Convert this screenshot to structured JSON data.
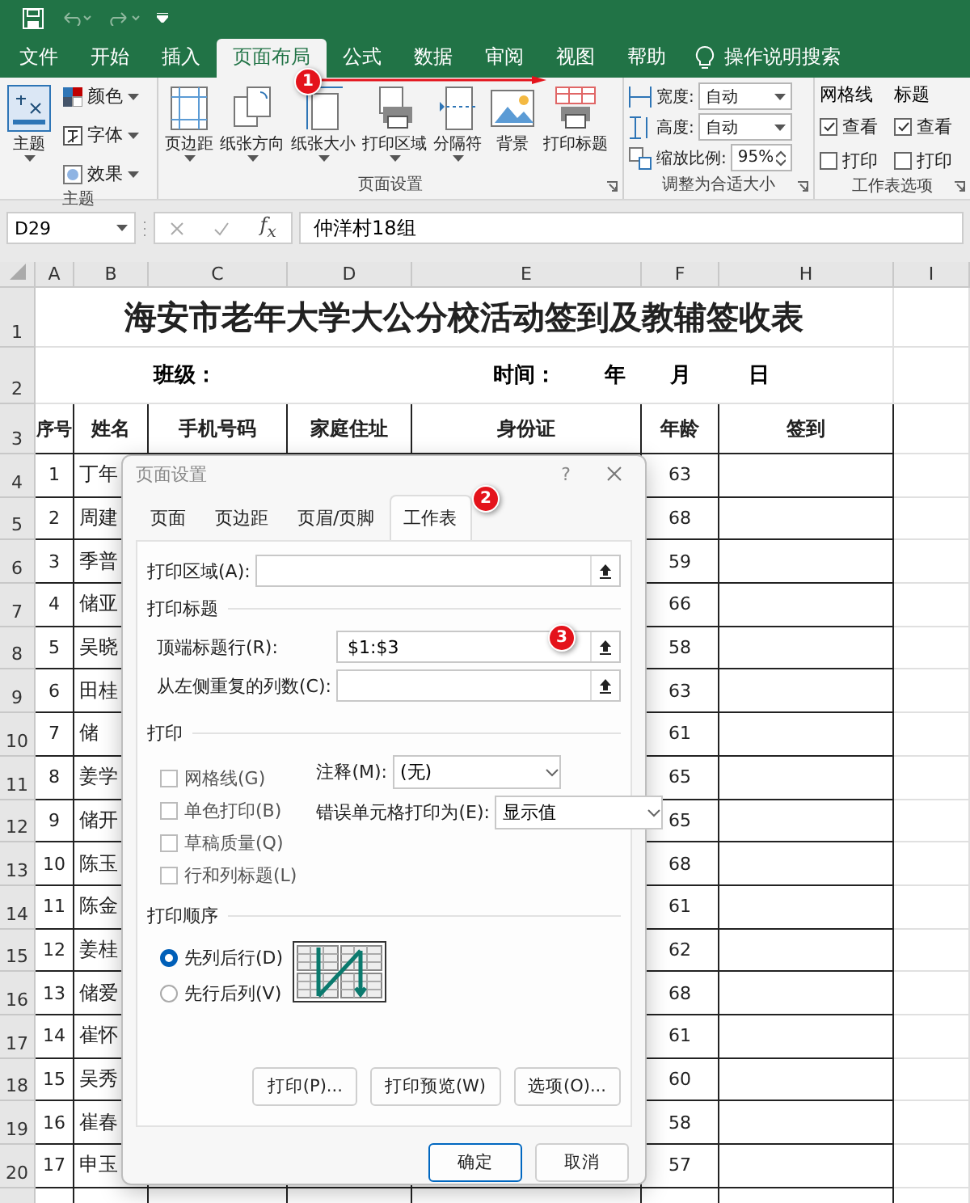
{
  "ribbon_tabs": [
    {
      "label": "文件",
      "selected": false
    },
    {
      "label": "开始",
      "selected": false
    },
    {
      "label": "插入",
      "selected": false
    },
    {
      "label": "页面布局",
      "selected": true
    },
    {
      "label": "公式",
      "selected": false
    },
    {
      "label": "数据",
      "selected": false
    },
    {
      "label": "审阅",
      "selected": false
    },
    {
      "label": "视图",
      "selected": false
    },
    {
      "label": "帮助",
      "selected": false
    }
  ],
  "tell_me": "操作说明搜索",
  "theme_group": {
    "label": "主题",
    "button": "主题",
    "items": [
      "颜色",
      "字体",
      "效果"
    ]
  },
  "page_setup_group": {
    "label": "页面设置",
    "buttons": [
      {
        "label": "页边距",
        "dropdown": true
      },
      {
        "label": "纸张方向",
        "dropdown": true
      },
      {
        "label": "纸张大小",
        "dropdown": true
      },
      {
        "label": "打印区域",
        "dropdown": true
      },
      {
        "label": "分隔符",
        "dropdown": true
      },
      {
        "label": "背景",
        "dropdown": false
      },
      {
        "label": "打印标题",
        "dropdown": false
      }
    ]
  },
  "scale_group": {
    "label": "调整为合适大小",
    "fields": [
      {
        "label": "宽度:",
        "value": "自动"
      },
      {
        "label": "高度:",
        "value": "自动"
      },
      {
        "label": "缩放比例:",
        "value": "95%"
      }
    ]
  },
  "sheet_options_group": {
    "label": "工作表选项",
    "columns": [
      {
        "title": "网格线",
        "options": [
          {
            "label": "查看",
            "checked": true
          },
          {
            "label": "打印",
            "checked": false
          }
        ]
      },
      {
        "title": "标题",
        "options": [
          {
            "label": "查看",
            "checked": true
          },
          {
            "label": "打印",
            "checked": false
          }
        ]
      }
    ]
  },
  "formula_bar": {
    "name_box": "D29",
    "function_label": "f$_{x}$",
    "formula": "仲洋村18组"
  },
  "sheet": {
    "columns": [
      "A",
      "B",
      "C",
      "D",
      "E",
      "F",
      "H",
      "I"
    ],
    "title_row": {
      "number": "1",
      "text": "海安市老年大学大公分校活动签到及教辅签收表"
    },
    "info_row": {
      "number": "2",
      "class_label": "班级：",
      "time_label": "时间：",
      "year": "年",
      "month": "月",
      "day": "日"
    },
    "header_row": {
      "number": "3",
      "cells": [
        "序号",
        "姓名",
        "手机号码",
        "家庭住址",
        "身份证",
        "年龄",
        "签到"
      ]
    },
    "rows": [
      {
        "number": "4",
        "seq": "1",
        "name": "丁年",
        "age": "63"
      },
      {
        "number": "5",
        "seq": "2",
        "name": "周建",
        "age": "68"
      },
      {
        "number": "6",
        "seq": "3",
        "name": "季普",
        "age": "59"
      },
      {
        "number": "7",
        "seq": "4",
        "name": "储亚",
        "age": "66"
      },
      {
        "number": "8",
        "seq": "5",
        "name": "吴晓",
        "age": "58"
      },
      {
        "number": "9",
        "seq": "6",
        "name": "田桂",
        "age": "63"
      },
      {
        "number": "10",
        "seq": "7",
        "name": "储",
        "age": "61"
      },
      {
        "number": "11",
        "seq": "8",
        "name": "姜学",
        "age": "65"
      },
      {
        "number": "12",
        "seq": "9",
        "name": "储开",
        "age": "65"
      },
      {
        "number": "13",
        "seq": "10",
        "name": "陈玉",
        "age": "68"
      },
      {
        "number": "14",
        "seq": "11",
        "name": "陈金",
        "age": "61"
      },
      {
        "number": "15",
        "seq": "12",
        "name": "姜桂",
        "age": "62"
      },
      {
        "number": "16",
        "seq": "13",
        "name": "储爱",
        "age": "68"
      },
      {
        "number": "17",
        "seq": "14",
        "name": "崔怀",
        "age": "61"
      },
      {
        "number": "18",
        "seq": "15",
        "name": "吴秀",
        "age": "60"
      },
      {
        "number": "19",
        "seq": "16",
        "name": "崔春",
        "age": "58"
      },
      {
        "number": "20",
        "seq": "17",
        "name": "申玉",
        "age": "57"
      }
    ]
  },
  "dialog": {
    "title": "页面设置",
    "help": "?",
    "tabs": [
      {
        "label": "页面",
        "selected": false
      },
      {
        "label": "页边距",
        "selected": false
      },
      {
        "label": "页眉/页脚",
        "selected": false
      },
      {
        "label": "工作表",
        "selected": true
      }
    ],
    "print_area_label": "打印区域(A):",
    "print_titles": {
      "heading": "打印标题",
      "fields": [
        {
          "label": "顶端标题行(R):",
          "value": "$1:$3"
        },
        {
          "label": "从左侧重复的列数(C):"
        }
      ]
    },
    "print": {
      "heading": "打印",
      "checkboxes": [
        {
          "label": "网格线(G)",
          "checked": false
        },
        {
          "label": "单色打印(B)",
          "checked": false
        },
        {
          "label": "草稿质量(Q)",
          "checked": false
        },
        {
          "label": "行和列标题(L)",
          "checked": false
        }
      ],
      "dropdowns": [
        {
          "label": "注释(M):",
          "value": "(无)"
        },
        {
          "label": "错误单元格打印为(E):",
          "value": "显示值"
        }
      ]
    },
    "print_order": {
      "heading": "打印顺序",
      "options": [
        {
          "label": "先列后行(D)",
          "selected": true
        },
        {
          "label": "先行后列(V)",
          "selected": false
        }
      ]
    },
    "buttons": [
      "打印(P)...",
      "打印预览(W)",
      "选项(O)..."
    ],
    "footer_buttons": [
      {
        "label": "确定",
        "default": true
      },
      {
        "label": "取消",
        "default": false
      }
    ]
  },
  "annotations": [
    "1",
    "2",
    "3"
  ]
}
